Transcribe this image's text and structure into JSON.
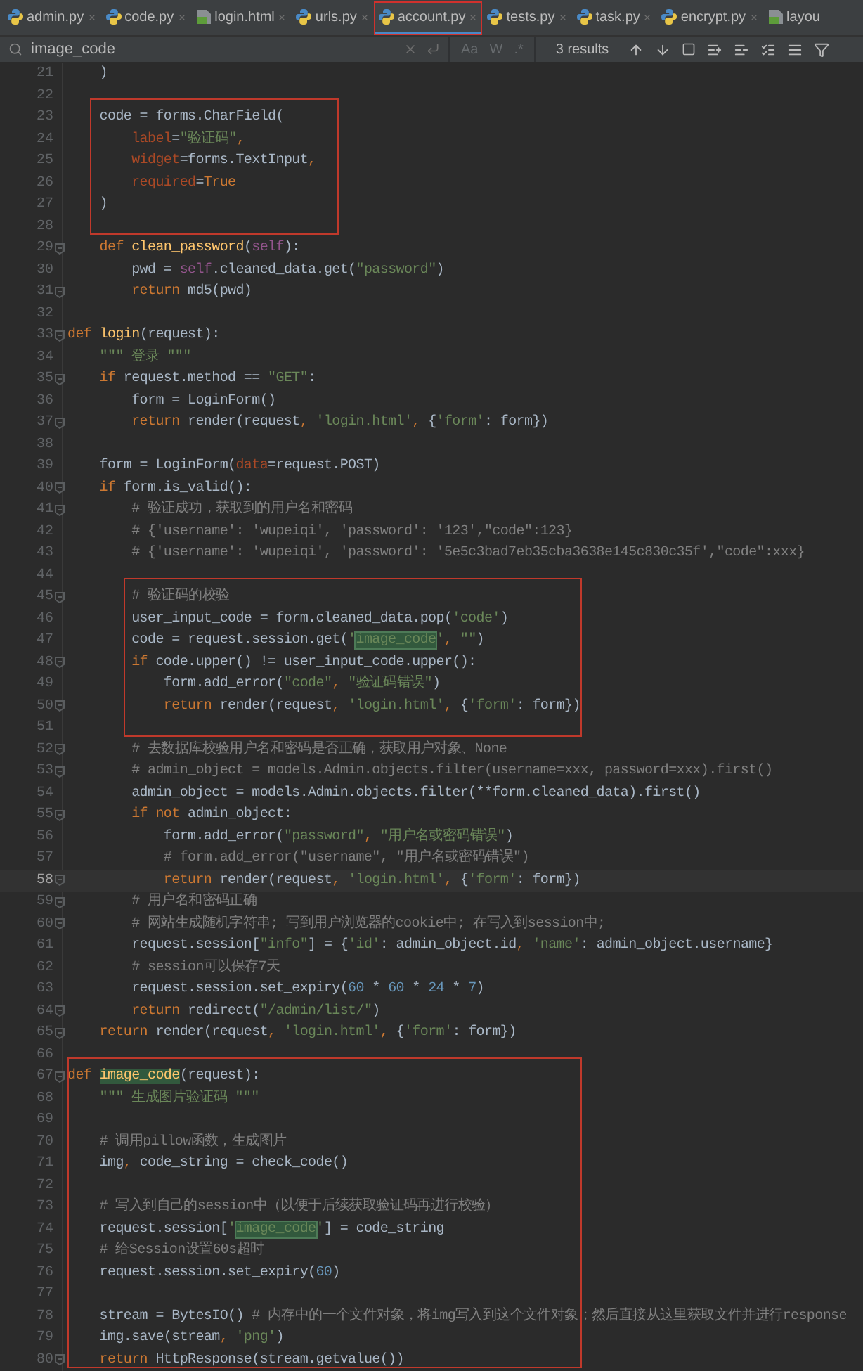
{
  "tabs": [
    {
      "label": "admin.py",
      "kind": "py",
      "selected": false,
      "highlighted": false
    },
    {
      "label": "code.py",
      "kind": "py",
      "selected": false,
      "highlighted": false
    },
    {
      "label": "login.html",
      "kind": "html",
      "selected": false,
      "highlighted": false
    },
    {
      "label": "urls.py",
      "kind": "py",
      "selected": false,
      "highlighted": false
    },
    {
      "label": "account.py",
      "kind": "py",
      "selected": true,
      "highlighted": true
    },
    {
      "label": "tests.py",
      "kind": "py",
      "selected": false,
      "highlighted": false
    },
    {
      "label": "task.py",
      "kind": "py",
      "selected": false,
      "highlighted": false
    },
    {
      "label": "encrypt.py",
      "kind": "py",
      "selected": false,
      "highlighted": false
    },
    {
      "label": "layou",
      "kind": "html",
      "selected": false,
      "highlighted": false
    }
  ],
  "search": {
    "value": "image_code",
    "options": [
      "Aa",
      "W",
      ".*"
    ],
    "results": "3 results"
  },
  "code_blocks": [
    {
      "boxed": false,
      "lines": [
        {
          "number": "21",
          "fold": false,
          "current": false,
          "tokens": [
            {
              "kind": "t",
              "text": "    )"
            }
          ]
        },
        {
          "number": "22",
          "fold": false,
          "current": false
        }
      ]
    },
    {
      "boxed": true,
      "lines": [
        {
          "number": "23",
          "fold": false,
          "current": false,
          "tokens": [
            {
              "kind": "t",
              "text": "    code = forms.CharField("
            }
          ]
        },
        {
          "number": "24",
          "fold": false,
          "current": false,
          "tokens": [
            {
              "kind": "p",
              "text": "        label"
            },
            {
              "kind": "t",
              "text": "="
            },
            {
              "kind": "s",
              "text": "\"验证码\""
            },
            {
              "kind": "k",
              "text": ","
            }
          ]
        },
        {
          "number": "25",
          "fold": false,
          "current": false,
          "tokens": [
            {
              "kind": "p",
              "text": "        widget"
            },
            {
              "kind": "t",
              "text": "=forms.TextInput"
            },
            {
              "kind": "k",
              "text": ","
            }
          ]
        },
        {
          "number": "26",
          "fold": false,
          "current": false,
          "tokens": [
            {
              "kind": "p",
              "text": "        required"
            },
            {
              "kind": "t",
              "text": "="
            },
            {
              "kind": "k",
              "text": "True"
            }
          ]
        },
        {
          "number": "27",
          "fold": false,
          "current": false,
          "tokens": [
            {
              "kind": "t",
              "text": "    )"
            }
          ]
        },
        {
          "number": "28",
          "fold": false,
          "current": false
        }
      ]
    },
    {
      "boxed": false,
      "lines": [
        {
          "number": "29",
          "fold": true,
          "current": false,
          "tokens": [
            {
              "kind": "k",
              "text": "    def "
            },
            {
              "kind": "f",
              "text": "clean_password"
            },
            {
              "kind": "t",
              "text": "("
            },
            {
              "kind": "self",
              "text": "self"
            },
            {
              "kind": "t",
              "text": "):"
            }
          ]
        },
        {
          "number": "30",
          "fold": false,
          "current": false,
          "tokens": [
            {
              "kind": "t",
              "text": "        pwd = "
            },
            {
              "kind": "self",
              "text": "self"
            },
            {
              "kind": "t",
              "text": ".cleaned_data.get("
            },
            {
              "kind": "s",
              "text": "\"password\""
            },
            {
              "kind": "t",
              "text": ")"
            }
          ]
        },
        {
          "number": "31",
          "fold": true,
          "current": false,
          "tokens": [
            {
              "kind": "k",
              "text": "        return "
            },
            {
              "kind": "t",
              "text": "md5(pwd)"
            }
          ]
        },
        {
          "number": "32",
          "fold": false,
          "current": false
        },
        {
          "number": "33",
          "fold": true,
          "current": false,
          "tokens": [
            {
              "kind": "k",
              "text": "def "
            },
            {
              "kind": "f",
              "text": "login"
            },
            {
              "kind": "t",
              "text": "(request):"
            }
          ]
        },
        {
          "number": "34",
          "fold": false,
          "current": false,
          "tokens": [
            {
              "kind": "s",
              "text": "    \"\"\" 登录 \"\"\""
            }
          ]
        },
        {
          "number": "35",
          "fold": true,
          "current": false,
          "tokens": [
            {
              "kind": "k",
              "text": "    if "
            },
            {
              "kind": "t",
              "text": "request.method == "
            },
            {
              "kind": "s",
              "text": "\"GET\""
            },
            {
              "kind": "t",
              "text": ":"
            }
          ]
        },
        {
          "number": "36",
          "fold": false,
          "current": false,
          "tokens": [
            {
              "kind": "t",
              "text": "        form = LoginForm()"
            }
          ]
        },
        {
          "number": "37",
          "fold": true,
          "current": false,
          "tokens": [
            {
              "kind": "k",
              "text": "        return "
            },
            {
              "kind": "t",
              "text": "render(request"
            },
            {
              "kind": "k",
              "text": ", "
            },
            {
              "kind": "s",
              "text": "'login.html'"
            },
            {
              "kind": "k",
              "text": ", "
            },
            {
              "kind": "t",
              "text": "{"
            },
            {
              "kind": "s",
              "text": "'form'"
            },
            {
              "kind": "t",
              "text": ": form})"
            }
          ]
        },
        {
          "number": "38",
          "fold": false,
          "current": false
        },
        {
          "number": "39",
          "fold": false,
          "current": false,
          "tokens": [
            {
              "kind": "t",
              "text": "    form = LoginForm("
            },
            {
              "kind": "p",
              "text": "data"
            },
            {
              "kind": "t",
              "text": "=request.POST)"
            }
          ]
        },
        {
          "number": "40",
          "fold": true,
          "current": false,
          "tokens": [
            {
              "kind": "k",
              "text": "    if "
            },
            {
              "kind": "t",
              "text": "form.is_valid():"
            }
          ]
        },
        {
          "number": "41",
          "fold": true,
          "current": false,
          "tokens": [
            {
              "kind": "c",
              "text": "        # 验证成功，获取到的用户名和密码"
            }
          ]
        },
        {
          "number": "42",
          "fold": false,
          "current": false,
          "tokens": [
            {
              "kind": "c",
              "text": "        # {'username': 'wupeiqi', 'password': '123',\"code\":123}"
            }
          ]
        },
        {
          "number": "43",
          "fold": false,
          "current": false,
          "tokens": [
            {
              "kind": "c",
              "text": "        # {'username': 'wupeiqi', 'password': '5e5c3bad7eb35cba3638e145c830c35f',\"code\":xxx}"
            }
          ]
        },
        {
          "number": "44",
          "fold": false,
          "current": false
        }
      ]
    },
    {
      "boxed": true,
      "lines": [
        {
          "number": "45",
          "fold": true,
          "current": false,
          "tokens": [
            {
              "kind": "c",
              "text": "        # 验证码的校验"
            }
          ]
        },
        {
          "number": "46",
          "fold": false,
          "current": false,
          "tokens": [
            {
              "kind": "t",
              "text": "        user_input_code = form.cleaned_data.pop("
            },
            {
              "kind": "s",
              "text": "'code'"
            },
            {
              "kind": "t",
              "text": ")"
            }
          ]
        },
        {
          "number": "47",
          "fold": false,
          "current": false,
          "tokens": [
            {
              "kind": "t",
              "text": "        code = request.session.get("
            },
            {
              "kind": "s",
              "text": "'"
            },
            {
              "kind": "m",
              "text": "image_code"
            },
            {
              "kind": "s",
              "text": "'"
            },
            {
              "kind": "k",
              "text": ", "
            },
            {
              "kind": "s",
              "text": "\"\""
            },
            {
              "kind": "t",
              "text": ")"
            }
          ]
        },
        {
          "number": "48",
          "fold": true,
          "current": false,
          "tokens": [
            {
              "kind": "k",
              "text": "        if "
            },
            {
              "kind": "t",
              "text": "code.upper() != user_input_code.upper():"
            }
          ]
        },
        {
          "number": "49",
          "fold": false,
          "current": false,
          "tokens": [
            {
              "kind": "t",
              "text": "            form.add_error("
            },
            {
              "kind": "s",
              "text": "\"code\""
            },
            {
              "kind": "k",
              "text": ", "
            },
            {
              "kind": "s",
              "text": "\"验证码错误\""
            },
            {
              "kind": "t",
              "text": ")"
            }
          ]
        },
        {
          "number": "50",
          "fold": true,
          "current": false,
          "tokens": [
            {
              "kind": "k",
              "text": "            return "
            },
            {
              "kind": "t",
              "text": "render(request"
            },
            {
              "kind": "k",
              "text": ", "
            },
            {
              "kind": "s",
              "text": "'login.html'"
            },
            {
              "kind": "k",
              "text": ", "
            },
            {
              "kind": "t",
              "text": "{"
            },
            {
              "kind": "s",
              "text": "'form'"
            },
            {
              "kind": "t",
              "text": ": form})"
            }
          ]
        },
        {
          "number": "51",
          "fold": false,
          "current": false
        }
      ]
    },
    {
      "boxed": false,
      "lines": [
        {
          "number": "52",
          "fold": true,
          "current": false,
          "tokens": [
            {
              "kind": "c",
              "text": "        # 去数据库校验用户名和密码是否正确，获取用户对象、None"
            }
          ]
        },
        {
          "number": "53",
          "fold": true,
          "current": false,
          "tokens": [
            {
              "kind": "c",
              "text": "        # admin_object = models.Admin.objects.filter(username=xxx, password=xxx).first()"
            }
          ]
        },
        {
          "number": "54",
          "fold": false,
          "current": false,
          "tokens": [
            {
              "kind": "t",
              "text": "        admin_object = models.Admin.objects.filter(**form.cleaned_data).first()"
            }
          ]
        },
        {
          "number": "55",
          "fold": true,
          "current": false,
          "tokens": [
            {
              "kind": "k",
              "text": "        if not "
            },
            {
              "kind": "t",
              "text": "admin_object:"
            }
          ]
        },
        {
          "number": "56",
          "fold": false,
          "current": false,
          "tokens": [
            {
              "kind": "t",
              "text": "            form.add_error("
            },
            {
              "kind": "s",
              "text": "\"password\""
            },
            {
              "kind": "k",
              "text": ", "
            },
            {
              "kind": "s",
              "text": "\"用户名或密码错误\""
            },
            {
              "kind": "t",
              "text": ")"
            }
          ]
        },
        {
          "number": "57",
          "fold": false,
          "current": false,
          "tokens": [
            {
              "kind": "c",
              "text": "            # form.add_error(\"username\", \"用户名或密码错误\")"
            }
          ]
        },
        {
          "number": "58",
          "fold": true,
          "current": true,
          "tokens": [
            {
              "kind": "k",
              "text": "            return "
            },
            {
              "kind": "t",
              "text": "render(request"
            },
            {
              "kind": "k",
              "text": ", "
            },
            {
              "kind": "s",
              "text": "'login.html'"
            },
            {
              "kind": "k",
              "text": ", "
            },
            {
              "kind": "t",
              "text": "{"
            },
            {
              "kind": "s",
              "text": "'form'"
            },
            {
              "kind": "t",
              "text": ": form})"
            }
          ]
        },
        {
          "number": "59",
          "fold": true,
          "current": false,
          "tokens": [
            {
              "kind": "c",
              "text": "        # 用户名和密码正确"
            }
          ]
        },
        {
          "number": "60",
          "fold": true,
          "current": false,
          "tokens": [
            {
              "kind": "c",
              "text": "        # 网站生成随机字符串; 写到用户浏览器的cookie中; 在写入到session中;"
            }
          ]
        },
        {
          "number": "61",
          "fold": false,
          "current": false,
          "tokens": [
            {
              "kind": "t",
              "text": "        request.session["
            },
            {
              "kind": "s",
              "text": "\"info\""
            },
            {
              "kind": "t",
              "text": "] = {"
            },
            {
              "kind": "s",
              "text": "'id'"
            },
            {
              "kind": "t",
              "text": ": admin_object.id"
            },
            {
              "kind": "k",
              "text": ", "
            },
            {
              "kind": "s",
              "text": "'name'"
            },
            {
              "kind": "t",
              "text": ": admin_object.username}"
            }
          ]
        },
        {
          "number": "62",
          "fold": false,
          "current": false,
          "tokens": [
            {
              "kind": "c",
              "text": "        # session可以保存7天"
            }
          ]
        },
        {
          "number": "63",
          "fold": false,
          "current": false,
          "tokens": [
            {
              "kind": "t",
              "text": "        request.session.set_expiry("
            },
            {
              "kind": "n",
              "text": "60"
            },
            {
              "kind": "t",
              "text": " * "
            },
            {
              "kind": "n",
              "text": "60"
            },
            {
              "kind": "t",
              "text": " * "
            },
            {
              "kind": "n",
              "text": "24"
            },
            {
              "kind": "t",
              "text": " * "
            },
            {
              "kind": "n",
              "text": "7"
            },
            {
              "kind": "t",
              "text": ")"
            }
          ]
        },
        {
          "number": "64",
          "fold": true,
          "current": false,
          "tokens": [
            {
              "kind": "k",
              "text": "        return "
            },
            {
              "kind": "t",
              "text": "redirect("
            },
            {
              "kind": "s",
              "text": "\"/admin/list/\""
            },
            {
              "kind": "t",
              "text": ")"
            }
          ]
        },
        {
          "number": "65",
          "fold": true,
          "current": false,
          "tokens": [
            {
              "kind": "k",
              "text": "    return "
            },
            {
              "kind": "t",
              "text": "render(request"
            },
            {
              "kind": "k",
              "text": ", "
            },
            {
              "kind": "s",
              "text": "'login.html'"
            },
            {
              "kind": "k",
              "text": ", "
            },
            {
              "kind": "t",
              "text": "{"
            },
            {
              "kind": "s",
              "text": "'form'"
            },
            {
              "kind": "t",
              "text": ": form})"
            }
          ]
        },
        {
          "number": "66",
          "fold": false,
          "current": false
        }
      ]
    },
    {
      "boxed": true,
      "lines": [
        {
          "number": "67",
          "fold": true,
          "current": false,
          "tokens": [
            {
              "kind": "k",
              "text": "def "
            },
            {
              "kind": "fm",
              "text": "image_code"
            },
            {
              "kind": "t",
              "text": "(request):"
            }
          ]
        },
        {
          "number": "68",
          "fold": false,
          "current": false,
          "tokens": [
            {
              "kind": "s",
              "text": "    \"\"\" 生成图片验证码 \"\"\""
            }
          ]
        },
        {
          "number": "69",
          "fold": false,
          "current": false
        },
        {
          "number": "70",
          "fold": false,
          "current": false,
          "tokens": [
            {
              "kind": "c",
              "text": "    # 调用pillow函数，生成图片"
            }
          ]
        },
        {
          "number": "71",
          "fold": false,
          "current": false,
          "tokens": [
            {
              "kind": "t",
              "text": "    img"
            },
            {
              "kind": "k",
              "text": ", "
            },
            {
              "kind": "t",
              "text": "code_string = check_code()"
            }
          ]
        },
        {
          "number": "72",
          "fold": false,
          "current": false
        },
        {
          "number": "73",
          "fold": false,
          "current": false,
          "tokens": [
            {
              "kind": "c",
              "text": "    # 写入到自己的session中（以便于后续获取验证码再进行校验）"
            }
          ]
        },
        {
          "number": "74",
          "fold": false,
          "current": false,
          "tokens": [
            {
              "kind": "t",
              "text": "    request.session["
            },
            {
              "kind": "s",
              "text": "'"
            },
            {
              "kind": "m",
              "text": "image_code"
            },
            {
              "kind": "s",
              "text": "'"
            },
            {
              "kind": "t",
              "text": "] = code_string"
            }
          ]
        },
        {
          "number": "75",
          "fold": false,
          "current": false,
          "tokens": [
            {
              "kind": "c",
              "text": "    # 给Session设置60s超时"
            }
          ]
        },
        {
          "number": "76",
          "fold": false,
          "current": false,
          "tokens": [
            {
              "kind": "t",
              "text": "    request.session.set_expiry("
            },
            {
              "kind": "n",
              "text": "60"
            },
            {
              "kind": "t",
              "text": ")"
            }
          ]
        },
        {
          "number": "77",
          "fold": false,
          "current": false
        },
        {
          "number": "78",
          "fold": false,
          "current": false,
          "tokens": [
            {
              "kind": "t",
              "text": "    stream = BytesIO() "
            },
            {
              "kind": "c",
              "text": "# 内存中的一个文件对象，将img写入到这个文件对象；然后直接从这里获取文件并进行response"
            }
          ]
        },
        {
          "number": "79",
          "fold": false,
          "current": false,
          "tokens": [
            {
              "kind": "t",
              "text": "    img.save(stream"
            },
            {
              "kind": "k",
              "text": ", "
            },
            {
              "kind": "s",
              "text": "'png'"
            },
            {
              "kind": "t",
              "text": ")"
            }
          ]
        },
        {
          "number": "80",
          "fold": true,
          "current": false,
          "tokens": [
            {
              "kind": "k",
              "text": "    return "
            },
            {
              "kind": "t",
              "text": "HttpResponse(stream.getvalue())"
            }
          ]
        }
      ]
    }
  ]
}
